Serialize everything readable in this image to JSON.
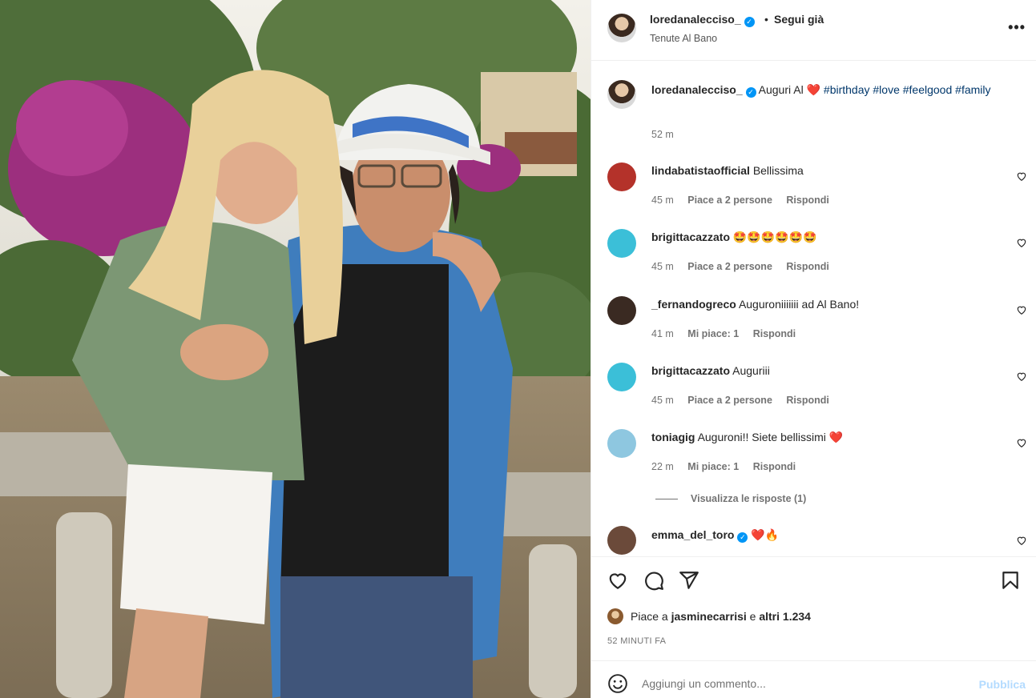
{
  "post": {
    "username": "loredanalecciso_",
    "follow_sep": "•",
    "follow_label": "Segui già",
    "location": "Tenute Al Bano",
    "more_label": "•••"
  },
  "caption": {
    "username": "loredanalecciso_",
    "text": "Auguri Al",
    "emoji": "❤️",
    "hashtags": [
      "#birthday",
      "#love",
      "#feelgood",
      "#family"
    ],
    "time": "52 m"
  },
  "comments": [
    {
      "username": "lindabatistaofficial",
      "text": "Bellissima",
      "time": "45 m",
      "likes": "Piace a 2 persone",
      "reply": "Rispondi",
      "avatar_color": "#b4322a"
    },
    {
      "username": "brigittacazzato",
      "text": "🤩🤩🤩🤩🤩🤩",
      "time": "45 m",
      "likes": "Piace a 2 persone",
      "reply": "Rispondi",
      "avatar_color": "#3bbfd8"
    },
    {
      "username": "_fernandogreco",
      "text": "Auguroniiiiiii ad Al Bano!",
      "time": "41 m",
      "likes": "Mi piace: 1",
      "reply": "Rispondi",
      "avatar_color": "#3a2a22"
    },
    {
      "username": "brigittacazzato",
      "text": "Auguriii",
      "time": "45 m",
      "likes": "Piace a 2 persone",
      "reply": "Rispondi",
      "avatar_color": "#3bbfd8"
    },
    {
      "username": "toniagig",
      "text": "Auguroni!! Siete bellissimi",
      "emoji": "❤️",
      "time": "22 m",
      "likes": "Mi piace: 1",
      "reply": "Rispondi",
      "avatar_color": "#8ec7e0"
    },
    {
      "username": "emma_del_toro",
      "text": "❤️🔥",
      "avatar_color": "#6b4a3a"
    }
  ],
  "view_replies": "Visualizza le risposte (1)",
  "likes": {
    "prefix": "Piace a",
    "user": "jasminecarrisi",
    "mid": "e",
    "others": "altri 1.234"
  },
  "time_ago": "52 MINUTI FA",
  "add_comment": {
    "placeholder": "Aggiungi un commento...",
    "publish": "Pubblica"
  },
  "colors": {
    "link": "#00376b",
    "verified": "#0095f6",
    "publish_disabled": "#b3dbff",
    "meta": "#737373"
  }
}
